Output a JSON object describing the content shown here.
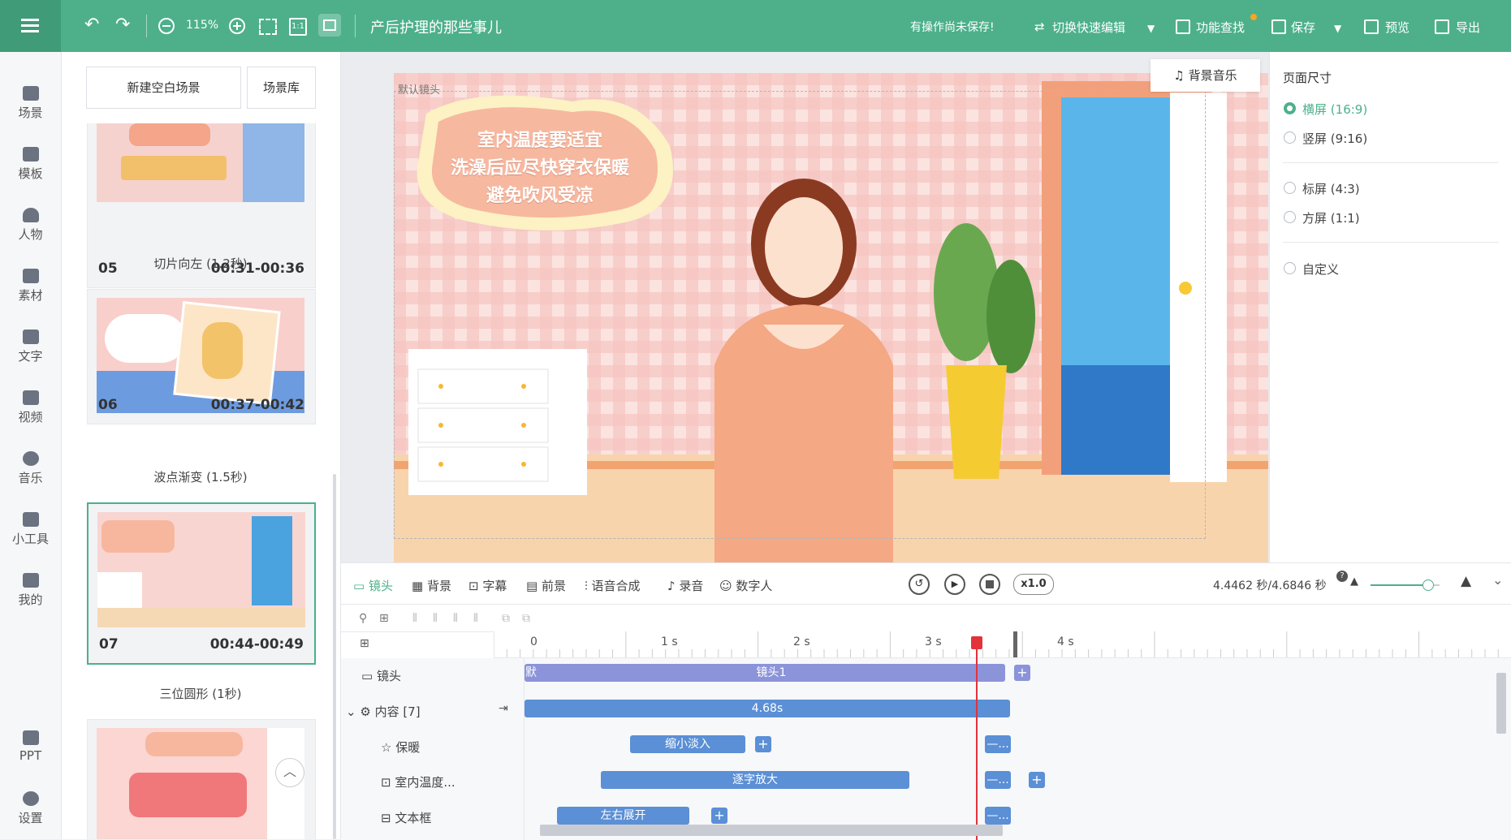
{
  "topbar": {
    "zoom": "115%",
    "doc_title": "产后护理的那些事儿",
    "unsaved": "有操作尚未保存!",
    "switch_quick_edit": "切换快速编辑",
    "feature_search": "功能查找",
    "save": "保存",
    "preview": "预览",
    "export": "导出"
  },
  "iconbar": {
    "items": [
      "场景",
      "模板",
      "人物",
      "素材",
      "文字",
      "视频",
      "音乐",
      "小工具",
      "我的",
      "PPT",
      "设置"
    ]
  },
  "scenes": {
    "new_blank": "新建空白场景",
    "library": "场景库",
    "cards": [
      {
        "num": "05",
        "time": "00:31-00:36"
      },
      {
        "num": "06",
        "time": "00:37-00:42"
      },
      {
        "num": "07",
        "time": "00:44-00:49"
      }
    ],
    "transitions": [
      "切片向左 (1.2秒)",
      "波点渐变 (1.5秒)",
      "三位圆形 (1秒)"
    ]
  },
  "canvas": {
    "bg_music": "背景音乐",
    "default_lens": "默认镜头",
    "banner_lines": [
      "室内温度要适宜",
      "洗澡后应尽快穿衣保暖",
      "避免吹风受凉"
    ]
  },
  "page_size": {
    "title": "页面尺寸",
    "options": [
      {
        "label": "横屏",
        "ratio": "(16:9)",
        "selected": true
      },
      {
        "label": "竖屏",
        "ratio": "(9:16)",
        "selected": false
      },
      {
        "label": "标屏",
        "ratio": "(4:3)",
        "selected": false
      },
      {
        "label": "方屏",
        "ratio": "(1:1)",
        "selected": false
      },
      {
        "label": "自定义",
        "ratio": "",
        "selected": false
      }
    ]
  },
  "timeline": {
    "tabs": [
      "镜头",
      "背景",
      "字幕",
      "前景",
      "语音合成",
      "录音",
      "数字人"
    ],
    "speed": "x1.0",
    "time_display": "4.4462 秒/4.6846 秒",
    "ticks": [
      "0",
      "1 s",
      "2 s",
      "3 s",
      "4 s"
    ],
    "rows": [
      {
        "label": "镜头",
        "bar": "镜头1",
        "bar_prefix": "默"
      },
      {
        "label": "内容 [7]",
        "bar": "4.68s"
      },
      {
        "label": "保暖",
        "bar": "缩小淡入"
      },
      {
        "label": "室内温度...",
        "bar": "逐字放大"
      },
      {
        "label": "文本框",
        "bar": "左右展开"
      }
    ],
    "end_marker": "—..."
  },
  "colors": {
    "brand": "#4db08b",
    "lens_bar": "#8b93d9",
    "content_bar": "#5b8fd6",
    "playhead": "#e2323c"
  }
}
